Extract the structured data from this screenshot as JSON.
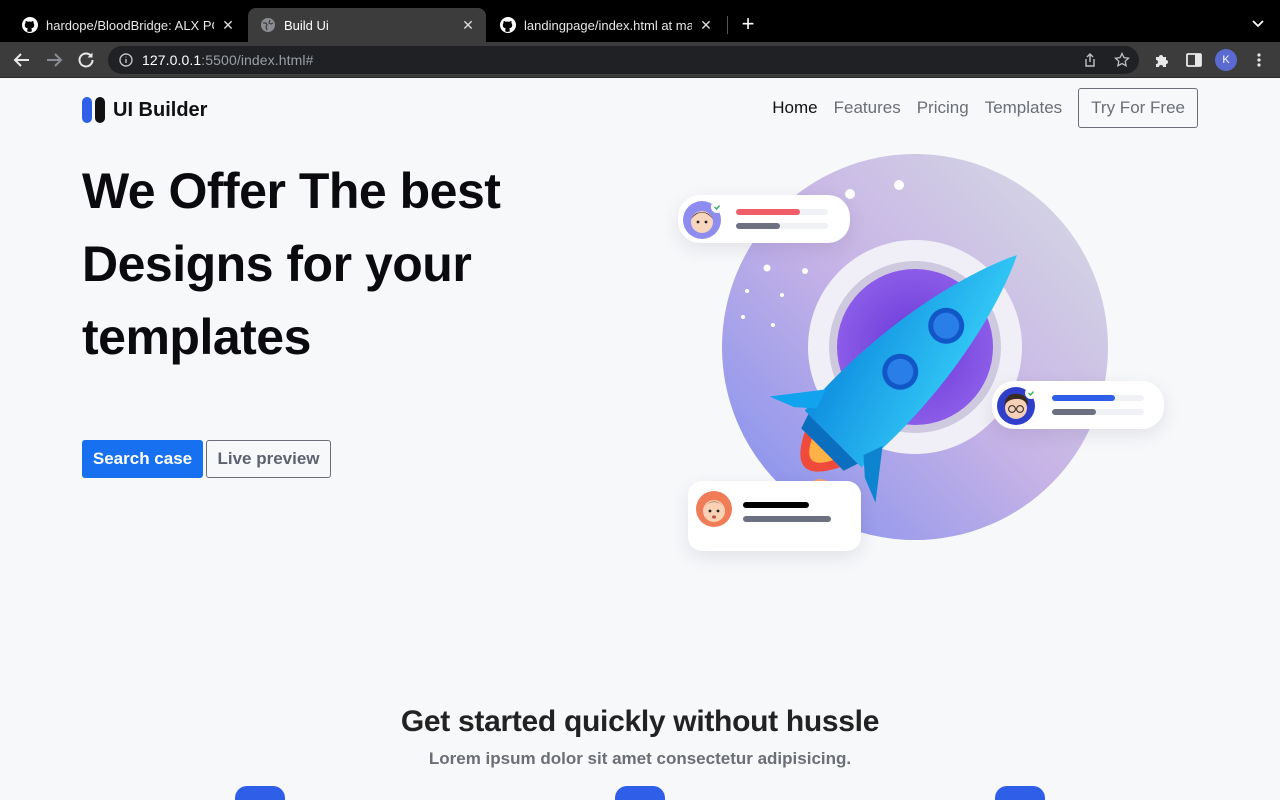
{
  "browser": {
    "tabs": [
      {
        "title": "hardope/BloodBridge: ALX PORTFOLIO",
        "icon": "github-icon",
        "active": false
      },
      {
        "title": "Build Ui",
        "icon": "globe-icon",
        "active": true
      },
      {
        "title": "landingpage/index.html at main",
        "icon": "github-icon",
        "active": false
      }
    ],
    "url_host": "127.0.0.1",
    "url_rest": ":5500/index.html#",
    "profile_initial": "K"
  },
  "site": {
    "logo_text": "UI Builder",
    "nav": {
      "home": "Home",
      "features": "Features",
      "pricing": "Pricing",
      "templates": "Templates",
      "try": "Try For Free"
    },
    "hero": {
      "line1": "We Offer The best",
      "line2": "Designs for your",
      "line3": "templates",
      "primary_button": "Search case",
      "secondary_button": "Live preview"
    },
    "section": {
      "title": "Get started quickly without hussle",
      "subtitle": "Lorem ipsum dolor sit amet consectetur adipisicing."
    }
  },
  "colors": {
    "accent": "#1670f0",
    "brand_blue": "#2f5fe8",
    "text_dark": "#0b0b0f",
    "text_muted": "#6b6e76"
  }
}
